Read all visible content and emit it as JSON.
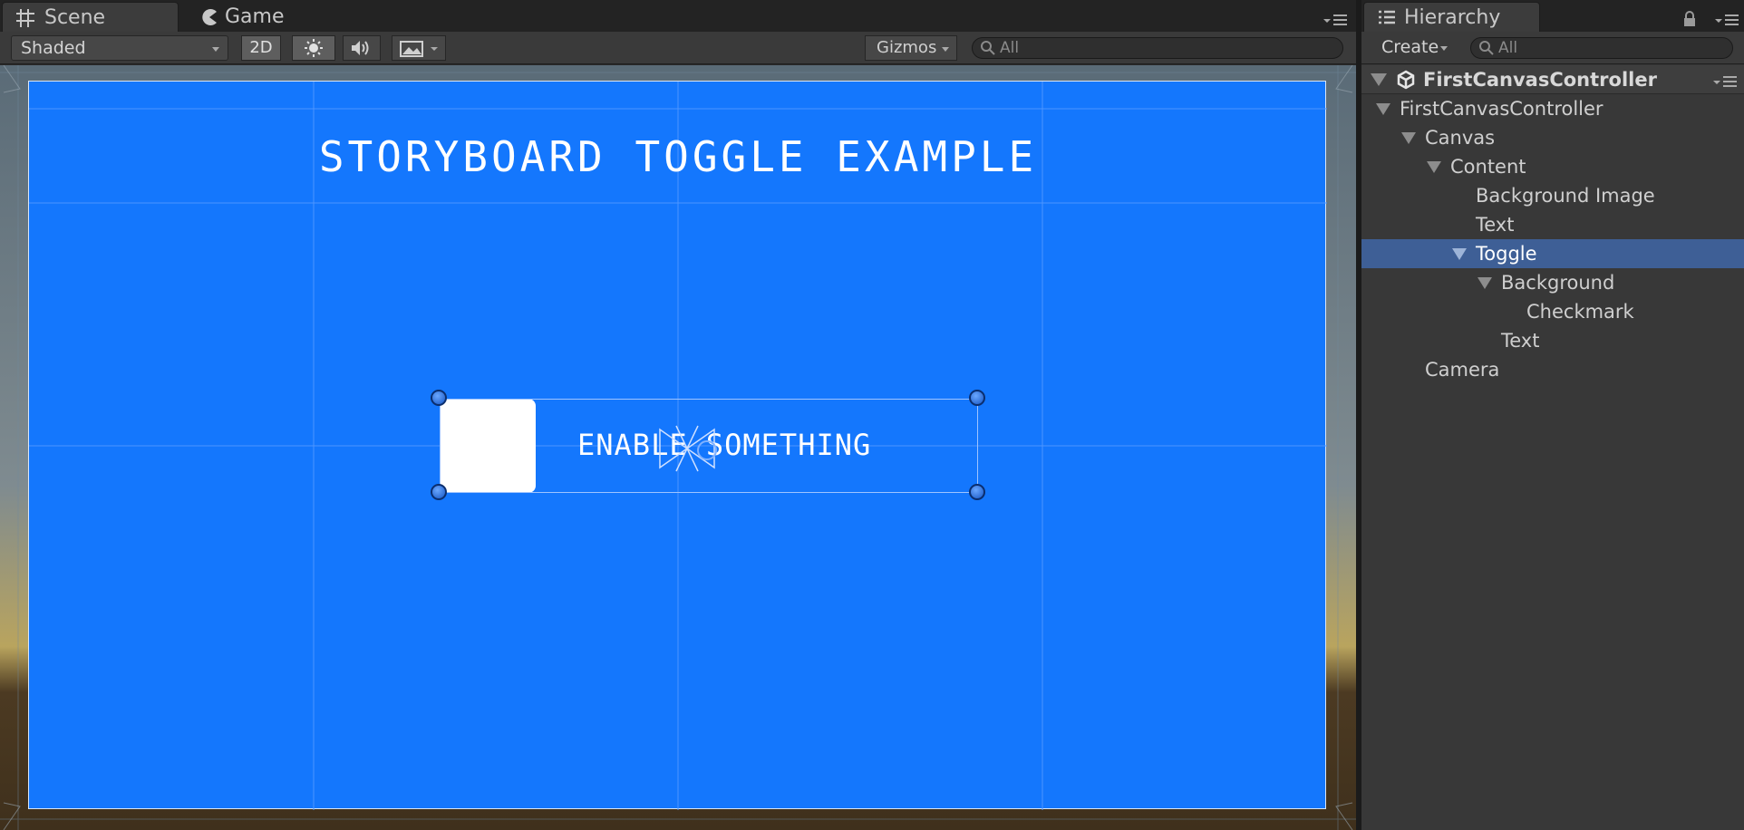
{
  "scene_tabs": {
    "scene_label": "Scene",
    "game_label": "Game"
  },
  "scene_toolbar": {
    "shading_mode": "Shaded",
    "mode_2d_label": "2D",
    "gizmos_label": "Gizmos",
    "search_placeholder": "All"
  },
  "scene_canvas": {
    "background_color": "#1477fd",
    "title": "STORYBOARD TOGGLE EXAMPLE",
    "toggle_label": "ENABLE SOMETHING",
    "checkbox_color": "#ffffff"
  },
  "hierarchy": {
    "tab_label": "Hierarchy",
    "create_label": "Create",
    "search_placeholder": "All",
    "scene_name": "FirstCanvasController",
    "selection_color": "#3e5f96",
    "items": [
      {
        "label": "FirstCanvasController",
        "depth": 1,
        "expanded": true,
        "selected": false
      },
      {
        "label": "Canvas",
        "depth": 2,
        "expanded": true,
        "selected": false
      },
      {
        "label": "Content",
        "depth": 3,
        "expanded": true,
        "selected": false
      },
      {
        "label": "Background Image",
        "depth": 4,
        "expanded": null,
        "selected": false
      },
      {
        "label": "Text",
        "depth": 4,
        "expanded": null,
        "selected": false
      },
      {
        "label": "Toggle",
        "depth": 4,
        "expanded": true,
        "selected": true
      },
      {
        "label": "Background",
        "depth": 5,
        "expanded": true,
        "selected": false
      },
      {
        "label": "Checkmark",
        "depth": 6,
        "expanded": null,
        "selected": false
      },
      {
        "label": "Text",
        "depth": 5,
        "expanded": null,
        "selected": false
      },
      {
        "label": "Camera",
        "depth": 2,
        "expanded": null,
        "selected": false
      }
    ]
  }
}
